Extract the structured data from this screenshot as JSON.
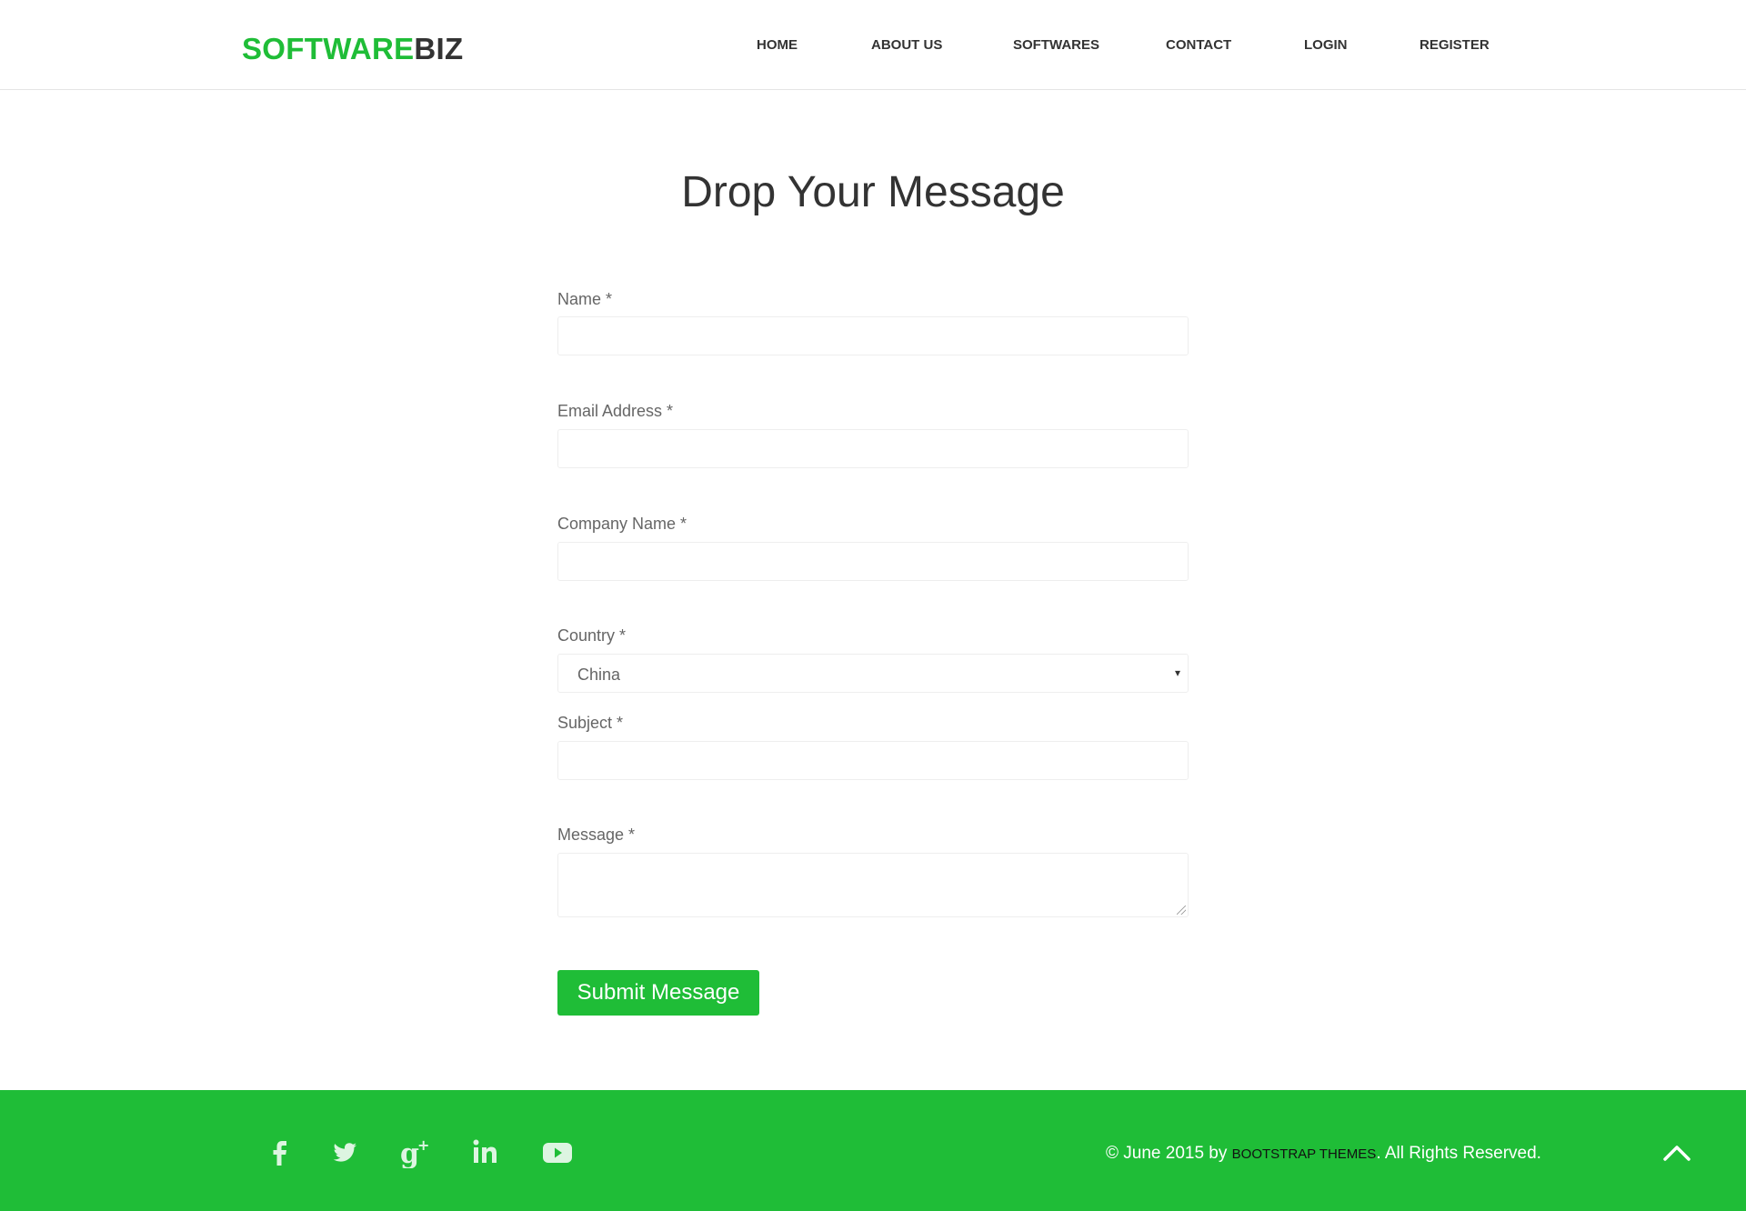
{
  "header": {
    "logo_part1": "SOFTWARE",
    "logo_part2": "BIZ",
    "nav": [
      {
        "label": "HOME"
      },
      {
        "label": "ABOUT US"
      },
      {
        "label": "SOFTWARES"
      },
      {
        "label": "CONTACT"
      },
      {
        "label": "LOGIN"
      },
      {
        "label": "REGISTER"
      }
    ]
  },
  "main": {
    "title": "Drop Your Message",
    "form": {
      "name_label": "Name *",
      "email_label": "Email Address *",
      "company_label": "Company Name *",
      "country_label": "Country *",
      "country_value": "China",
      "subject_label": "Subject *",
      "message_label": "Message *",
      "submit_label": "Submit Message"
    }
  },
  "footer": {
    "social_icons": [
      "facebook-icon",
      "twitter-icon",
      "google-plus-icon",
      "linkedin-icon",
      "youtube-icon"
    ],
    "copyright_prefix": "© June 2015 by ",
    "copyright_brand": "BOOTSTRAP THEMES",
    "copyright_suffix": ". All Rights Reserved."
  },
  "colors": {
    "brand_green": "#1fbd37",
    "text_dark": "#333333",
    "label_gray": "#666666"
  }
}
